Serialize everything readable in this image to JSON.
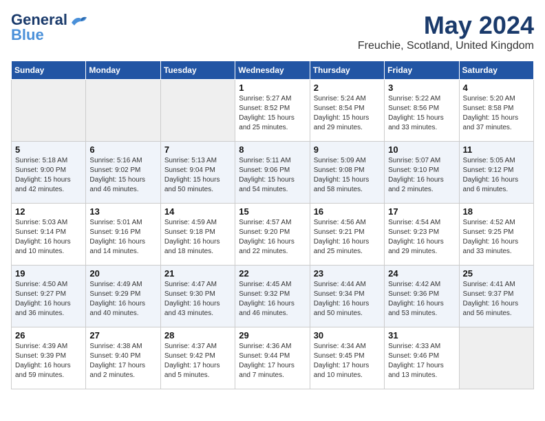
{
  "header": {
    "logo_line1": "General",
    "logo_line2": "Blue",
    "month": "May 2024",
    "location": "Freuchie, Scotland, United Kingdom"
  },
  "weekdays": [
    "Sunday",
    "Monday",
    "Tuesday",
    "Wednesday",
    "Thursday",
    "Friday",
    "Saturday"
  ],
  "weeks": [
    [
      {
        "day": "",
        "empty": true
      },
      {
        "day": "",
        "empty": true
      },
      {
        "day": "",
        "empty": true
      },
      {
        "day": "1",
        "sunrise": "5:27 AM",
        "sunset": "8:52 PM",
        "daylight": "15 hours and 25 minutes."
      },
      {
        "day": "2",
        "sunrise": "5:24 AM",
        "sunset": "8:54 PM",
        "daylight": "15 hours and 29 minutes."
      },
      {
        "day": "3",
        "sunrise": "5:22 AM",
        "sunset": "8:56 PM",
        "daylight": "15 hours and 33 minutes."
      },
      {
        "day": "4",
        "sunrise": "5:20 AM",
        "sunset": "8:58 PM",
        "daylight": "15 hours and 37 minutes."
      }
    ],
    [
      {
        "day": "5",
        "sunrise": "5:18 AM",
        "sunset": "9:00 PM",
        "daylight": "15 hours and 42 minutes."
      },
      {
        "day": "6",
        "sunrise": "5:16 AM",
        "sunset": "9:02 PM",
        "daylight": "15 hours and 46 minutes."
      },
      {
        "day": "7",
        "sunrise": "5:13 AM",
        "sunset": "9:04 PM",
        "daylight": "15 hours and 50 minutes."
      },
      {
        "day": "8",
        "sunrise": "5:11 AM",
        "sunset": "9:06 PM",
        "daylight": "15 hours and 54 minutes."
      },
      {
        "day": "9",
        "sunrise": "5:09 AM",
        "sunset": "9:08 PM",
        "daylight": "15 hours and 58 minutes."
      },
      {
        "day": "10",
        "sunrise": "5:07 AM",
        "sunset": "9:10 PM",
        "daylight": "16 hours and 2 minutes."
      },
      {
        "day": "11",
        "sunrise": "5:05 AM",
        "sunset": "9:12 PM",
        "daylight": "16 hours and 6 minutes."
      }
    ],
    [
      {
        "day": "12",
        "sunrise": "5:03 AM",
        "sunset": "9:14 PM",
        "daylight": "16 hours and 10 minutes."
      },
      {
        "day": "13",
        "sunrise": "5:01 AM",
        "sunset": "9:16 PM",
        "daylight": "16 hours and 14 minutes."
      },
      {
        "day": "14",
        "sunrise": "4:59 AM",
        "sunset": "9:18 PM",
        "daylight": "16 hours and 18 minutes."
      },
      {
        "day": "15",
        "sunrise": "4:57 AM",
        "sunset": "9:20 PM",
        "daylight": "16 hours and 22 minutes."
      },
      {
        "day": "16",
        "sunrise": "4:56 AM",
        "sunset": "9:21 PM",
        "daylight": "16 hours and 25 minutes."
      },
      {
        "day": "17",
        "sunrise": "4:54 AM",
        "sunset": "9:23 PM",
        "daylight": "16 hours and 29 minutes."
      },
      {
        "day": "18",
        "sunrise": "4:52 AM",
        "sunset": "9:25 PM",
        "daylight": "16 hours and 33 minutes."
      }
    ],
    [
      {
        "day": "19",
        "sunrise": "4:50 AM",
        "sunset": "9:27 PM",
        "daylight": "16 hours and 36 minutes."
      },
      {
        "day": "20",
        "sunrise": "4:49 AM",
        "sunset": "9:29 PM",
        "daylight": "16 hours and 40 minutes."
      },
      {
        "day": "21",
        "sunrise": "4:47 AM",
        "sunset": "9:30 PM",
        "daylight": "16 hours and 43 minutes."
      },
      {
        "day": "22",
        "sunrise": "4:45 AM",
        "sunset": "9:32 PM",
        "daylight": "16 hours and 46 minutes."
      },
      {
        "day": "23",
        "sunrise": "4:44 AM",
        "sunset": "9:34 PM",
        "daylight": "16 hours and 50 minutes."
      },
      {
        "day": "24",
        "sunrise": "4:42 AM",
        "sunset": "9:36 PM",
        "daylight": "16 hours and 53 minutes."
      },
      {
        "day": "25",
        "sunrise": "4:41 AM",
        "sunset": "9:37 PM",
        "daylight": "16 hours and 56 minutes."
      }
    ],
    [
      {
        "day": "26",
        "sunrise": "4:39 AM",
        "sunset": "9:39 PM",
        "daylight": "16 hours and 59 minutes."
      },
      {
        "day": "27",
        "sunrise": "4:38 AM",
        "sunset": "9:40 PM",
        "daylight": "17 hours and 2 minutes."
      },
      {
        "day": "28",
        "sunrise": "4:37 AM",
        "sunset": "9:42 PM",
        "daylight": "17 hours and 5 minutes."
      },
      {
        "day": "29",
        "sunrise": "4:36 AM",
        "sunset": "9:44 PM",
        "daylight": "17 hours and 7 minutes."
      },
      {
        "day": "30",
        "sunrise": "4:34 AM",
        "sunset": "9:45 PM",
        "daylight": "17 hours and 10 minutes."
      },
      {
        "day": "31",
        "sunrise": "4:33 AM",
        "sunset": "9:46 PM",
        "daylight": "17 hours and 13 minutes."
      },
      {
        "day": "",
        "empty": true
      }
    ]
  ]
}
